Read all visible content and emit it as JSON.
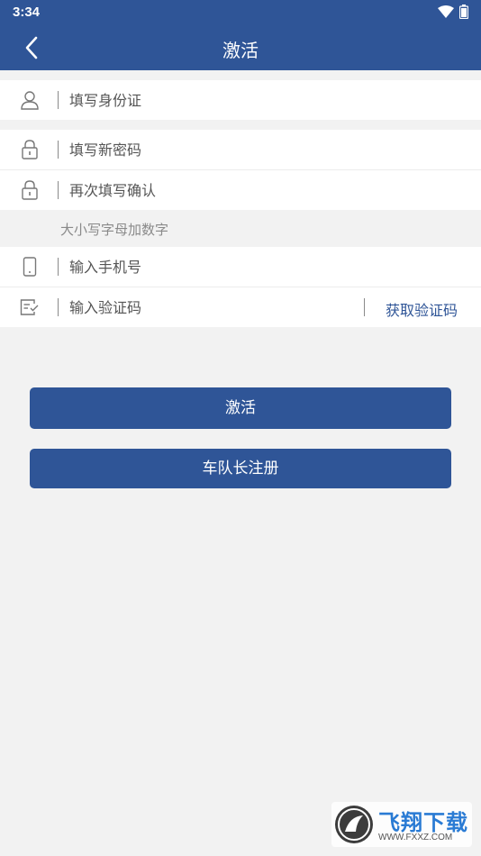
{
  "status_bar": {
    "time": "3:34",
    "wifi_icon": "wifi-icon",
    "battery_icon": "battery-icon"
  },
  "app_bar": {
    "back_icon": "chevron-left-icon",
    "title": "激活"
  },
  "form": {
    "id_card": {
      "icon": "user-icon",
      "placeholder": "填写身份证"
    },
    "new_password": {
      "icon": "lock-icon",
      "placeholder": "填写新密码"
    },
    "confirm_password": {
      "icon": "lock-icon",
      "placeholder": "再次填写确认"
    },
    "password_hint": "大小写字母加数字",
    "phone": {
      "icon": "phone-icon",
      "placeholder": "输入手机号"
    },
    "verify_code": {
      "icon": "edit-note-icon",
      "placeholder": "输入验证码",
      "get_code_label": "获取验证码"
    }
  },
  "buttons": {
    "activate": "激活",
    "captain_register": "车队长注册"
  },
  "watermark": {
    "text": "飞翔下载",
    "url": "WWW.FXXZ.COM"
  },
  "colors": {
    "brand": "#2f5597",
    "background": "#f2f2f2",
    "row_background": "#ffffff",
    "hint_text": "#8a8a8a"
  }
}
